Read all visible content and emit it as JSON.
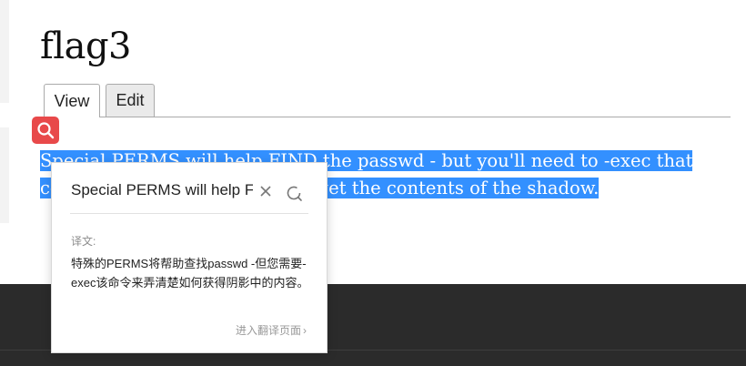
{
  "page": {
    "title": "flag3",
    "tabs": [
      {
        "label": "View"
      },
      {
        "label": "Edit"
      }
    ],
    "content_text": "Special PERMS will help FIND the passwd - but you'll need to -exec that command to figure out how to get the contents of the shadow."
  },
  "popup": {
    "source_text": "Special PERMS will help FIND the passwd - but you'll need to -exec that command to figure out how to get the contents of the shadow.",
    "translation_label": "译文:",
    "translation": "特殊的PERMS将帮助查找passwd -但您需要-exec该命令来弄清楚如何获得阴影中的内容。",
    "open_page_link": "进入翻译页面",
    "link_chevron": "›"
  },
  "colors": {
    "selection": "#3390ff",
    "badge": "#e8494a",
    "footer": "#2b2b2b"
  },
  "icons": {
    "badge": "search-icon",
    "close": "close-icon",
    "refresh": "refresh-icon"
  }
}
